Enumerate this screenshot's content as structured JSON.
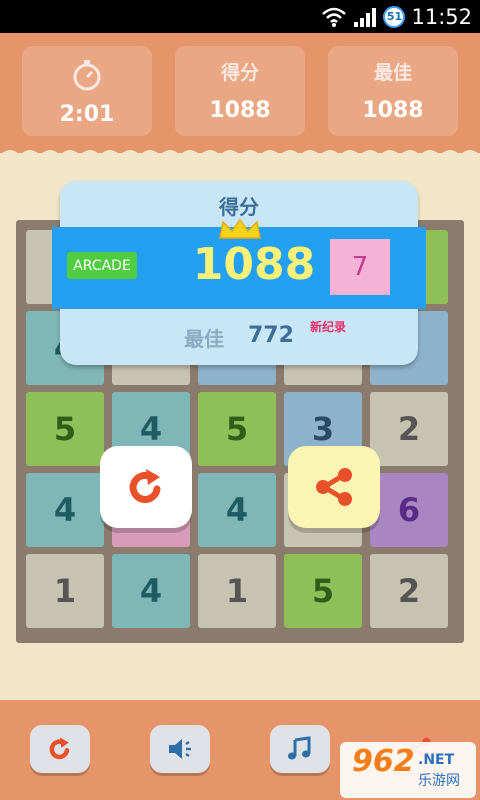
{
  "status_bar": {
    "time": "11:52",
    "badge": "51"
  },
  "stats": {
    "timer": {
      "icon": "stopwatch-icon",
      "value": "2:01"
    },
    "score": {
      "label": "得分",
      "value": "1088"
    },
    "best": {
      "label": "最佳",
      "value": "1088"
    }
  },
  "board": {
    "rows": [
      [
        "",
        "",
        "",
        "",
        ""
      ],
      [
        "4",
        "",
        "",
        "",
        ""
      ],
      [
        "5",
        "4",
        "5",
        "3",
        "2"
      ],
      [
        "4",
        "",
        "4",
        "",
        "6"
      ],
      [
        "1",
        "4",
        "1",
        "5",
        "2"
      ]
    ]
  },
  "popup": {
    "title": "得分",
    "mode": "ARCADE",
    "score": "1088",
    "max_tile": "7",
    "best_label": "最佳",
    "best_value": "772",
    "new_record": "新纪录"
  },
  "actions": {
    "restart_icon": "restart-icon",
    "share_icon": "share-icon"
  },
  "footer": {
    "buttons": [
      "restart-icon",
      "sound-icon",
      "music-icon",
      "share-icon"
    ]
  },
  "watermark": {
    "brand": "962",
    "domain": ".NET",
    "sub": "乐游网"
  },
  "colors": {
    "header": "#e6946a",
    "popup": "#c9e6f7",
    "score_band": "#24a0f2",
    "score_text": "#f8f17a",
    "new_record": "#ea2f6a"
  }
}
